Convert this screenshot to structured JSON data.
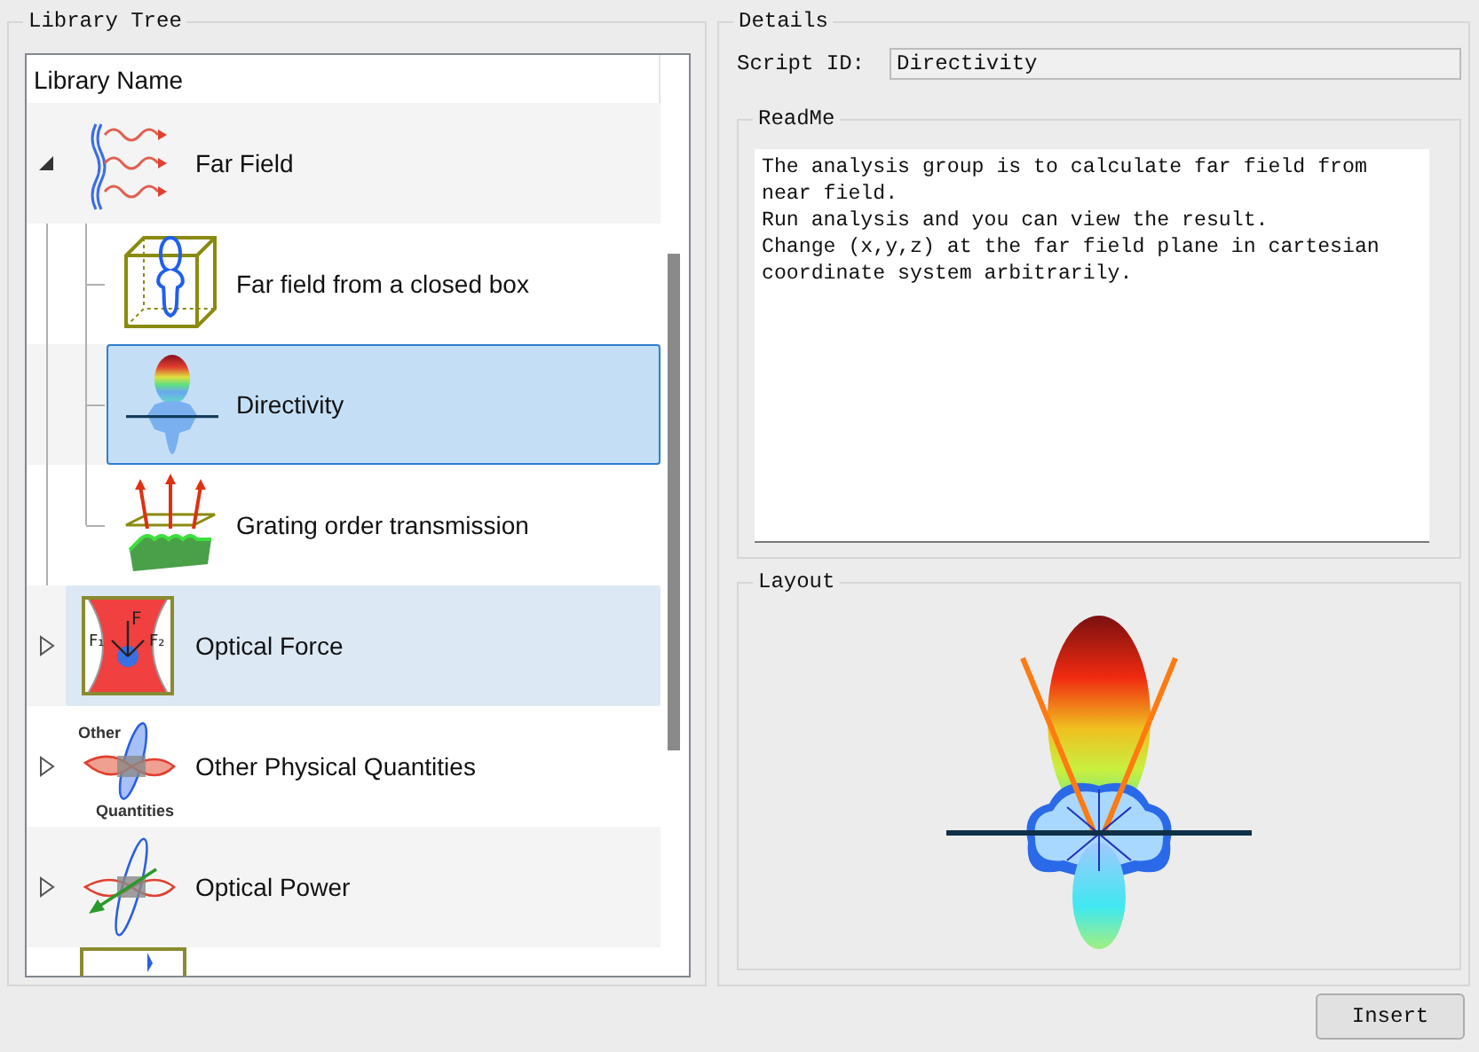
{
  "library_tree": {
    "title": "Library Tree",
    "header": "Library Name",
    "items": [
      {
        "label": "Far Field",
        "expanded": true,
        "selected": false,
        "hovered": false,
        "children": [
          {
            "label": "Far field from a closed box",
            "selected": false,
            "hovered": false
          },
          {
            "label": "Directivity",
            "selected": true,
            "hovered": false
          },
          {
            "label": "Grating order transmission",
            "selected": false,
            "hovered": false
          }
        ]
      },
      {
        "label": "Optical Force",
        "expanded": false,
        "selected": false,
        "hovered": true,
        "icon_labels": [
          "F",
          "F₁",
          "F₂"
        ]
      },
      {
        "label": "Other Physical Quantities",
        "expanded": false,
        "selected": false,
        "hovered": false,
        "icon_labels": [
          "Other",
          "Quantities"
        ]
      },
      {
        "label": "Optical Power",
        "expanded": false,
        "selected": false,
        "hovered": false
      }
    ]
  },
  "details": {
    "title": "Details",
    "script_id_label": "Script ID:",
    "script_id": "Directivity",
    "readme": {
      "title": "ReadMe",
      "text": "The analysis group is to calculate far field from\nnear field.\nRun analysis and you can view the result.\nChange (x,y,z) at the far field plane in cartesian\ncoordinate system arbitrarily."
    },
    "layout": {
      "title": "Layout"
    }
  },
  "buttons": [
    "Insert"
  ]
}
